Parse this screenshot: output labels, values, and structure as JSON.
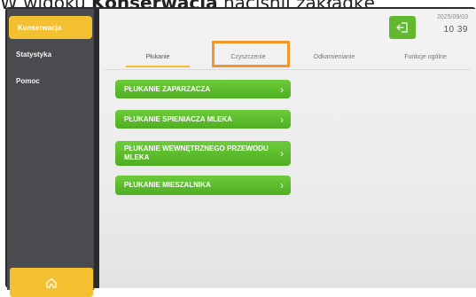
{
  "caption": {
    "prefix": "W widoku ",
    "bold": "Konserwacja",
    "suffix": " naciśnij zakładkę"
  },
  "sidebar": {
    "items": [
      {
        "label": "Konserwacja",
        "active": true
      },
      {
        "label": "Statystyka",
        "active": false
      },
      {
        "label": "Pomoc",
        "active": false
      }
    ],
    "home_icon": "home-icon"
  },
  "header": {
    "exit_icon": "logout-icon",
    "date": "2025/09/03",
    "time": "10 39"
  },
  "tabs": [
    {
      "label": "Płukanie",
      "active": true
    },
    {
      "label": "Czyszczenie",
      "active": false,
      "highlighted": true
    },
    {
      "label": "Odkamienianie",
      "active": false
    },
    {
      "label": "Funkcje ogólne",
      "active": false
    }
  ],
  "actions": [
    {
      "label": "PŁUKANIE ZAPARZACZA"
    },
    {
      "label": "PŁUKANIE SPIENIACZA MLEKA"
    },
    {
      "label": "PŁUKANIE WEWNĘTRZNEGO PRZEWODU MLEKA"
    },
    {
      "label": "PŁUKANIE MIESZALNIKA"
    }
  ],
  "colors": {
    "accent": "#f3c032",
    "green": "#5cbb2c",
    "highlight": "#f3952c"
  }
}
